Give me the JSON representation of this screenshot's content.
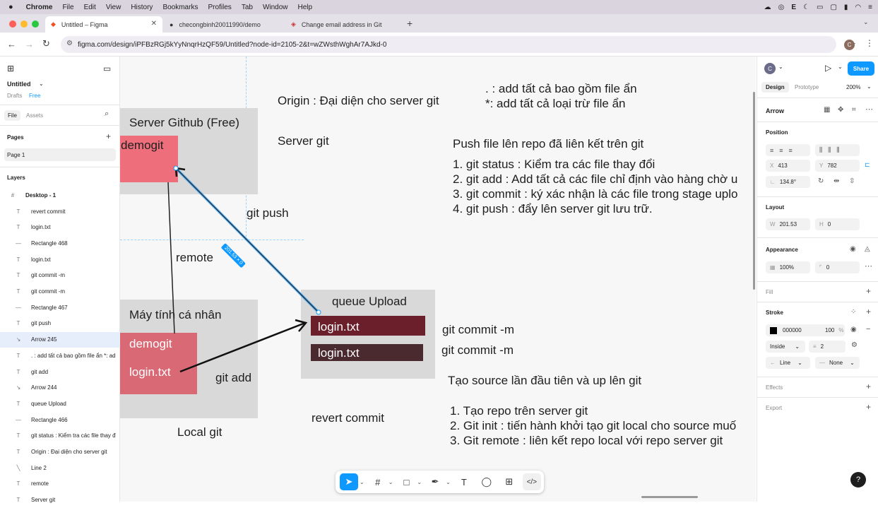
{
  "menubar": {
    "items": [
      "Chrome",
      "File",
      "Edit",
      "View",
      "History",
      "Bookmarks",
      "Profiles",
      "Tab",
      "Window",
      "Help"
    ]
  },
  "browser": {
    "tabs": [
      {
        "label": "Untitled – Figma",
        "active": true
      },
      {
        "label": "checongbinh20011990/demo"
      },
      {
        "label": "Change email address in Git"
      }
    ],
    "url": "figma.com/design/iPFBzRGj5kYyNnqrHzQF59/Untitled?node-id=2105-2&t=wZWsthWghAr7AJkd-0",
    "profile_initial": "C"
  },
  "left": {
    "file_title": "Untitled",
    "drafts": "Drafts",
    "plan": "Free",
    "tab_file": "File",
    "tab_assets": "Assets",
    "pages_header": "Pages",
    "page1": "Page 1",
    "layers_header": "Layers",
    "frame": "Desktop - 1",
    "layers": [
      {
        "icon": "T",
        "label": "revert commit"
      },
      {
        "icon": "T",
        "label": "login.txt"
      },
      {
        "icon": "—",
        "label": "Rectangle 468"
      },
      {
        "icon": "T",
        "label": "login.txt"
      },
      {
        "icon": "T",
        "label": "git commit -m"
      },
      {
        "icon": "T",
        "label": "git commit -m"
      },
      {
        "icon": "—",
        "label": "Rectangle 467"
      },
      {
        "icon": "T",
        "label": "git push"
      },
      {
        "icon": "↘",
        "label": "Arrow 245",
        "selected": true
      },
      {
        "icon": "T",
        "label": ". : add tất cả bao gồm file ẩn *: ad"
      },
      {
        "icon": "T",
        "label": "git add"
      },
      {
        "icon": "↘",
        "label": "Arrow 244"
      },
      {
        "icon": "T",
        "label": "queue Upload"
      },
      {
        "icon": "—",
        "label": "Rectangle 466"
      },
      {
        "icon": "T",
        "label": "git status : Kiểm tra các file thay đ"
      },
      {
        "icon": "T",
        "label": "Origin : Đại diện cho server git"
      },
      {
        "icon": "╲",
        "label": "Line 2"
      },
      {
        "icon": "T",
        "label": "remote"
      },
      {
        "icon": "T",
        "label": "Server git"
      }
    ]
  },
  "canvas": {
    "server_github": "Server Github (Free)",
    "demogit_top": "demogit",
    "origin": "Origin : Đại diện cho server git",
    "server_git": "Server git",
    "git_push": "git push",
    "remote": "remote",
    "dim_badge": "201.53 × 0",
    "dot_line1": ". : add tất cả bao gồm file ẩn",
    "dot_line2": "*:  add tất cả loại trừ file ẩn",
    "push_title": "Push file lên repo đã liên kết trên git",
    "push_steps": [
      "1. git status : Kiểm tra các file thay đổi",
      "2. git add : Add tất cả các file chỉ định vào hàng chờ u",
      "3. git commit : ký xác nhận là các file trong stage uplo",
      "4. git push : đẩy lên server git lưu trữ."
    ],
    "queue_upload": "queue Upload",
    "login1": "login.txt",
    "login2": "login.txt",
    "commit1": "git commit -m",
    "commit2": "git commit -m",
    "may_tinh": "Máy tính cá nhân",
    "demogit_local": "demogit",
    "login_local": "login.txt",
    "git_add": "git add",
    "local_git": "Local git",
    "revert_commit": "revert commit",
    "source_title": "Tạo source lần đầu tiên và up lên git",
    "source_steps": [
      "1. Tạo repo trên server git",
      "2. Git init : tiến hành khởi tạo git local cho source muố",
      "3. Git remote : liên kết repo local với repo server git"
    ]
  },
  "right": {
    "avatar": "C",
    "share": "Share",
    "tab_design": "Design",
    "tab_prototype": "Prototype",
    "zoom": "200%",
    "selection": "Arrow",
    "position": "Position",
    "x": "413",
    "y": "782",
    "rotation": "134.8°",
    "layout": "Layout",
    "w": "201.53",
    "h": "0",
    "appearance": "Appearance",
    "opacity": "100%",
    "radius": "0",
    "fill": "Fill",
    "stroke": "Stroke",
    "stroke_color": "000000",
    "stroke_opacity": "100",
    "stroke_pos": "Inside",
    "stroke_weight": "2",
    "start_cap": "Line",
    "end_cap": "None",
    "effects": "Effects",
    "export": "Export"
  },
  "colors": {
    "accent": "#0d99ff",
    "box_gray": "#d9d9d9",
    "pink": "#ee6f7b",
    "rose": "#d96a75",
    "dark_red": "#6b1f2a",
    "dark_brown": "#4a2a2e"
  }
}
